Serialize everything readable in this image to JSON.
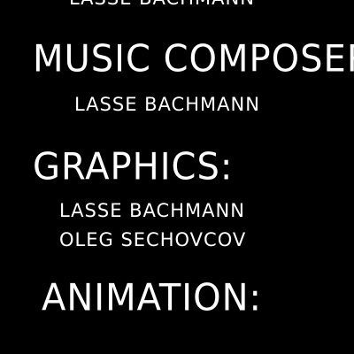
{
  "credits": {
    "previous_name": "LASSE BACHMANN",
    "music_heading": "MUSIC COMPOSER:",
    "music_name": "LASSE BACHMANN",
    "graphics_heading": "GRAPHICS:",
    "graphics_names": [
      "LASSE BACHMANN",
      "OLEG SECHOVCOV"
    ],
    "animation_heading": "ANIMATION:"
  },
  "colors": {
    "background": "#000000",
    "text": "#ffffff"
  }
}
